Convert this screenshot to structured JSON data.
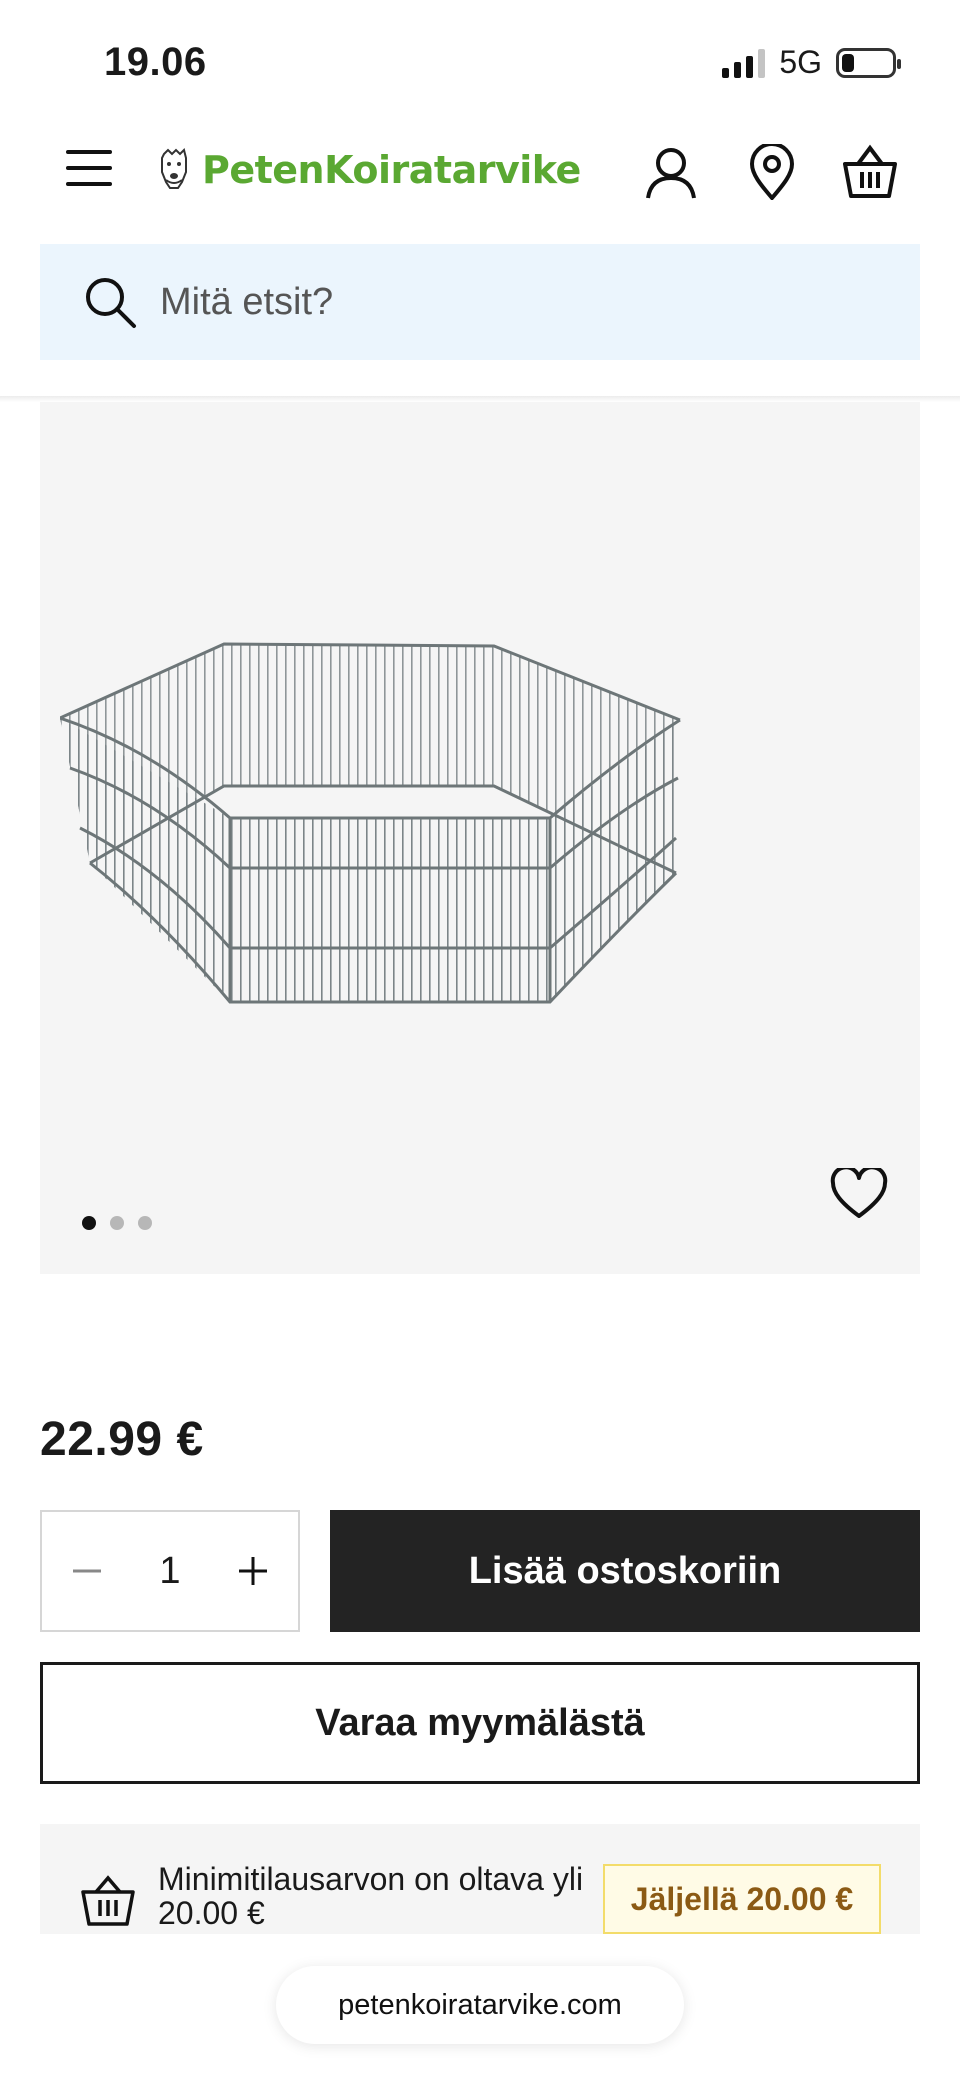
{
  "status_bar": {
    "time": "19.06",
    "network": "5G"
  },
  "header": {
    "logo_text": "PetenKoiratarvike",
    "icons": [
      "menu-icon",
      "user-icon",
      "location-pin-icon",
      "basket-icon"
    ],
    "brand_color": "#5aa832"
  },
  "search": {
    "placeholder": "Mitä etsit?"
  },
  "product": {
    "image": "wire-playpen",
    "gallery_count": 3,
    "gallery_active": 1,
    "price": "22.99 €",
    "quantity": "1",
    "add_to_cart_label": "Lisää ostoskoriin",
    "reserve_label": "Varaa myymälästä"
  },
  "min_order": {
    "message": "Minimitilausarvon on oltava yli 20.00 €",
    "remaining_label": "Jäljellä 20.00 €"
  },
  "browser": {
    "url": "petenkoiratarvike.com"
  }
}
